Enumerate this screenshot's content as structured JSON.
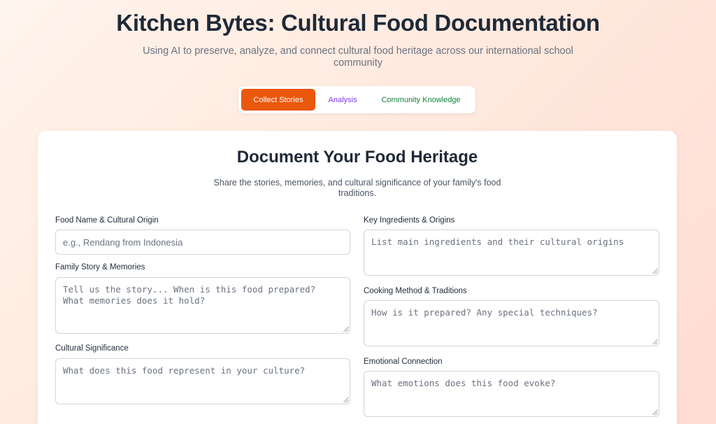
{
  "header": {
    "title": "Kitchen Bytes: Cultural Food Documentation",
    "subtitle": "Using AI to preserve, analyze, and connect cultural food heritage across our international school community"
  },
  "tabs": [
    {
      "label": "Collect Stories",
      "active": true
    },
    {
      "label": "Analysis",
      "active": false
    },
    {
      "label": "Community Knowledge",
      "active": false
    }
  ],
  "form": {
    "title": "Document Your Food Heritage",
    "subtitle": "Share the stories, memories, and cultural significance of your family's food traditions.",
    "fields": {
      "food_name": {
        "label": "Food Name & Cultural Origin",
        "placeholder": "e.g., Rendang from Indonesia"
      },
      "family_story": {
        "label": "Family Story & Memories",
        "placeholder": "Tell us the story... When is this food prepared?\nWhat memories does it hold?"
      },
      "cultural_significance": {
        "label": "Cultural Significance",
        "placeholder": "What does this food represent in your culture?"
      },
      "ingredients": {
        "label": "Key Ingredients & Origins",
        "placeholder": "List main ingredients and their cultural origins"
      },
      "cooking_method": {
        "label": "Cooking Method & Traditions",
        "placeholder": "How is it prepared? Any special techniques?"
      },
      "emotional_connection": {
        "label": "Emotional Connection",
        "placeholder": "What emotions does this food evoke?"
      }
    }
  },
  "colors": {
    "accent": "#ea580c",
    "analysis_tab": "#7c3aed",
    "community_tab": "#15803d"
  }
}
